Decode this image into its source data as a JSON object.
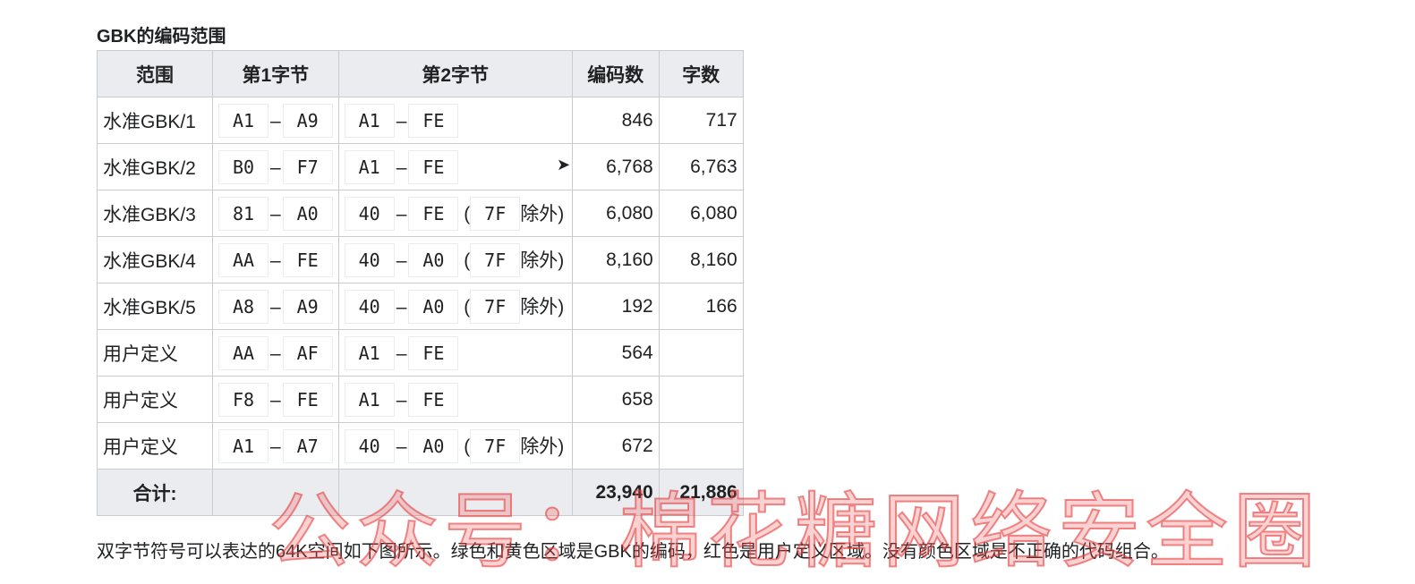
{
  "title": "GBK的编码范围",
  "headers": [
    "范围",
    "第1字节",
    "第2字节",
    "编码数",
    "字数"
  ],
  "rows": [
    {
      "range": "水准GBK/1",
      "b1": [
        "A1",
        "A9"
      ],
      "b2": [
        "A1",
        "FE"
      ],
      "ex": "",
      "count": "846",
      "chars": "717"
    },
    {
      "range": "水准GBK/2",
      "b1": [
        "B0",
        "F7"
      ],
      "b2": [
        "A1",
        "FE"
      ],
      "ex": "",
      "count": "6,768",
      "chars": "6,763"
    },
    {
      "range": "水准GBK/3",
      "b1": [
        "81",
        "A0"
      ],
      "b2": [
        "40",
        "FE"
      ],
      "ex": "7F",
      "count": "6,080",
      "chars": "6,080"
    },
    {
      "range": "水准GBK/4",
      "b1": [
        "AA",
        "FE"
      ],
      "b2": [
        "40",
        "A0"
      ],
      "ex": "7F",
      "count": "8,160",
      "chars": "8,160"
    },
    {
      "range": "水准GBK/5",
      "b1": [
        "A8",
        "A9"
      ],
      "b2": [
        "40",
        "A0"
      ],
      "ex": "7F",
      "count": "192",
      "chars": "166"
    },
    {
      "range": "用户定义",
      "b1": [
        "AA",
        "AF"
      ],
      "b2": [
        "A1",
        "FE"
      ],
      "ex": "",
      "count": "564",
      "chars": ""
    },
    {
      "range": "用户定义",
      "b1": [
        "F8",
        "FE"
      ],
      "b2": [
        "A1",
        "FE"
      ],
      "ex": "",
      "count": "658",
      "chars": ""
    },
    {
      "range": "用户定义",
      "b1": [
        "A1",
        "A7"
      ],
      "b2": [
        "40",
        "A0"
      ],
      "ex": "7F",
      "count": "672",
      "chars": ""
    }
  ],
  "total": {
    "label": "合计:",
    "count": "23,940",
    "chars": "21,886"
  },
  "dash": "–",
  "except_open": "(",
  "except_close": "除外)",
  "paragraph": "双字节符号可以表达的64K空间如下图所示。绿色和黄色区域是GBK的编码，红色是用户定义区域。没有颜色区域是不正确的代码组合。",
  "watermark": "公众号：棉花糖网络安全圈"
}
